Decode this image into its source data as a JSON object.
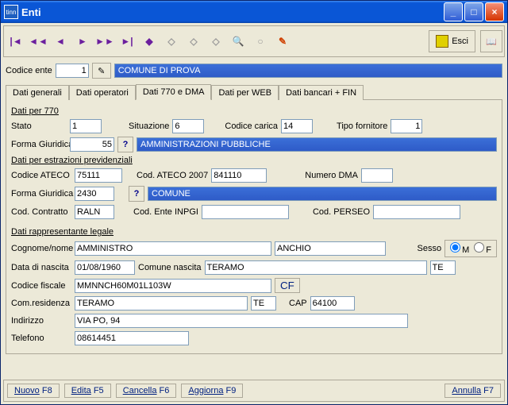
{
  "window": {
    "title": "Enti",
    "icon": "tinn"
  },
  "toolbar": {
    "esci": "Esci"
  },
  "header": {
    "codice_label": "Codice ente",
    "codice_value": "1",
    "ente_name": "COMUNE DI PROVA"
  },
  "tabs": [
    "Dati generali",
    "Dati operatori",
    "Dati 770 e DMA",
    "Dati per WEB",
    "Dati bancari + FIN"
  ],
  "active_tab": 2,
  "s770": {
    "title": "Dati per 770",
    "stato_l": "Stato",
    "stato": "1",
    "situazione_l": "Situazione",
    "situazione": "6",
    "carica_l": "Codice carica",
    "carica": "14",
    "tipofornitore_l": "Tipo fornitore",
    "tipofornitore": "1",
    "fg_l": "Forma Giuridica",
    "fg": "55",
    "fg_desc": "AMMINISTRAZIONI PUBBLICHE"
  },
  "sprev": {
    "title": "Dati per estrazioni previdenziali",
    "ateco_l": "Codice ATECO",
    "ateco": "75111",
    "ateco07_l": "Cod. ATECO 2007",
    "ateco07": "841110",
    "dma_l": "Numero DMA",
    "dma": "",
    "fg_l": "Forma Giuridica",
    "fg": "2430",
    "fg_desc": "COMUNE",
    "contr_l": "Cod. Contratto",
    "contr": "RALN",
    "inpgi_l": "Cod. Ente INPGI",
    "inpgi": "",
    "perseo_l": "Cod. PERSEO",
    "perseo": ""
  },
  "srapp": {
    "title": "Dati rappresentante legale",
    "cognome_l": "Cognome/nome",
    "cognome": "AMMINISTRO",
    "nome": "ANCHIO",
    "sesso_l": "Sesso",
    "sesso_m": "M",
    "sesso_f": "F",
    "dn_l": "Data di nascita",
    "dn": "01/08/1960",
    "cn_l": "Comune nascita",
    "cn": "TERAMO",
    "pn": "TE",
    "cf_l": "Codice fiscale",
    "cf": "MMNNCH60M01L103W",
    "cf_btn": "CF",
    "res_l": "Com.residenza",
    "res": "TERAMO",
    "resp": "TE",
    "cap_l": "CAP",
    "cap": "64100",
    "ind_l": "Indirizzo",
    "ind": "VIA PO, 94",
    "tel_l": "Telefono",
    "tel": "08614451"
  },
  "footer": {
    "nuovo": "Nuovo",
    "nuovo_k": "  F8",
    "edita": "Edita",
    "edita_k": "  F5",
    "cancella": "Cancella",
    "cancella_k": "  F6",
    "aggiorna": "Aggiorna",
    "aggiorna_k": "  F9",
    "annulla": "Annulla",
    "annulla_k": "  F7"
  }
}
